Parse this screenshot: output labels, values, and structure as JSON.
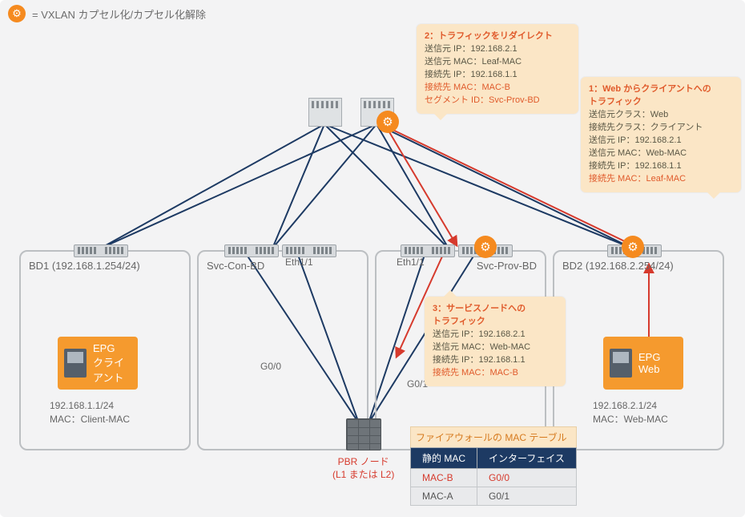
{
  "legend": {
    "text": "= VXLAN カプセル化/カプセル化解除"
  },
  "bd1": {
    "title": "BD1 (192.168.1.254/24)"
  },
  "bd2": {
    "title": "Svc-Con-BD"
  },
  "bd3": {
    "title": "Svc-Prov-BD"
  },
  "bd4": {
    "title": "BD2 (192.168.2.254/24)"
  },
  "ports": {
    "eth_left": "Eth1/1",
    "eth_right": "Eth1/1",
    "g00": "G0/0",
    "g01": "G0/1"
  },
  "pbr": {
    "l1": "PBR ノード",
    "l2": "(L1 または L2)"
  },
  "epg_client": {
    "l1": "EPG",
    "l2": "クライ",
    "l3": "アント",
    "ip": "192.168.1.1/24",
    "mac": "MAC：Client-MAC"
  },
  "epg_web": {
    "l1": "EPG",
    "l2": "Web",
    "ip": "192.168.2.1/24",
    "mac": "MAC：Web-MAC"
  },
  "callout1": {
    "hd1": "1：Web からクライアントへの",
    "hd2": "トラフィック",
    "r1": "送信元クラス：Web",
    "r2": "接続先クラス：クライアント",
    "r3": "送信元 IP：192.168.2.1",
    "r4": "送信元 MAC：Web-MAC",
    "r5": "接続先 IP：192.168.1.1",
    "r6": "接続先 MAC：Leaf-MAC"
  },
  "callout2": {
    "hd": "2：トラフィックをリダイレクト",
    "r1": "送信元 IP：192.168.2.1",
    "r2": "送信元 MAC：Leaf-MAC",
    "r3": "接続先 IP：192.168.1.1",
    "r4": "接続先 MAC：MAC-B",
    "r5": "セグメント ID：Svc-Prov-BD"
  },
  "callout3": {
    "hd1": "3：サービスノードへの",
    "hd2": "トラフィック",
    "r1": "送信元 IP：192.168.2.1",
    "r2": "送信元 MAC：Web-MAC",
    "r3": "接続先 IP：192.168.1.1",
    "r4": "接続先 MAC：MAC-B"
  },
  "mac_table": {
    "caption": "ファイアウォールの MAC テーブル",
    "h1": "静的 MAC",
    "h2": "インターフェイス",
    "rows": [
      {
        "mac": "MAC-B",
        "if": "G0/0",
        "hl": true
      },
      {
        "mac": "MAC-A",
        "if": "G0/1",
        "hl": false
      }
    ]
  },
  "arrow_color_topo": "#1d3a63",
  "arrow_color_flow": "#d63a2d"
}
